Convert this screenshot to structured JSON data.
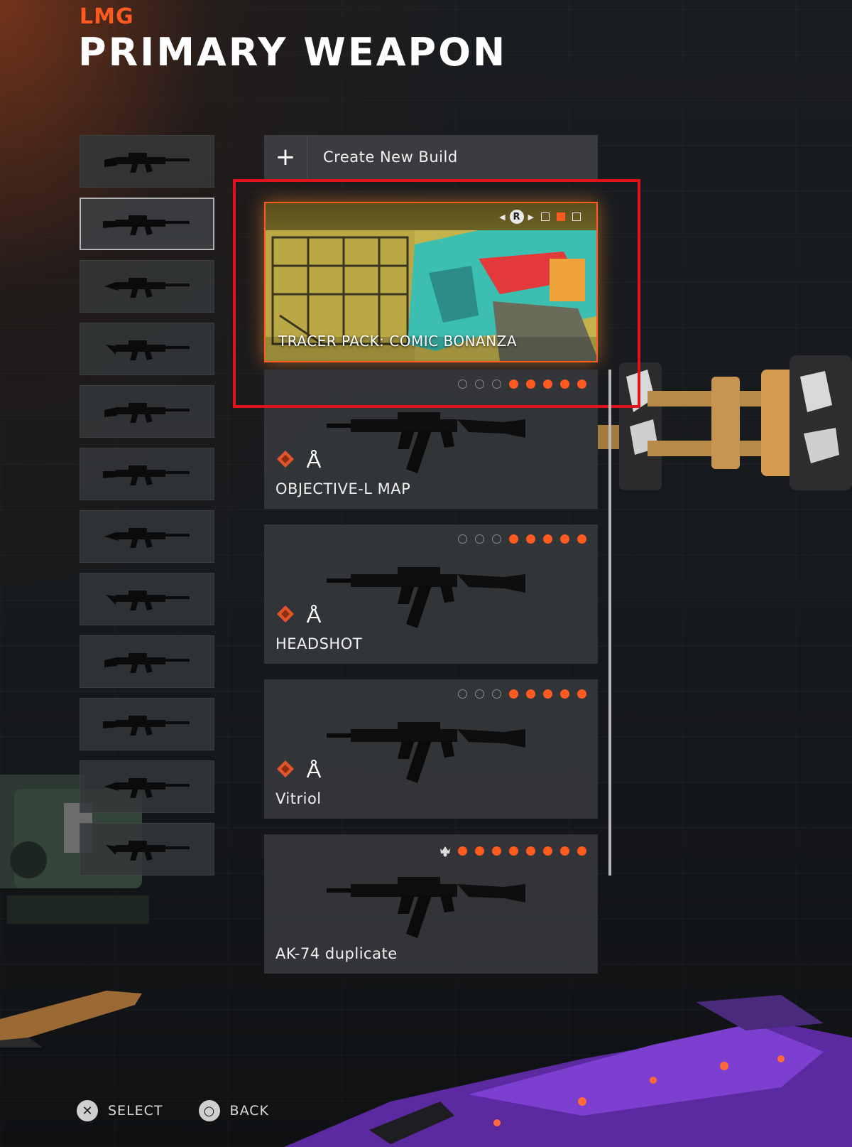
{
  "header": {
    "category": "LMG",
    "title": "PRIMARY WEAPON"
  },
  "weapon_list": {
    "count": 12,
    "selected_index": 1
  },
  "builds": {
    "create_label": "Create New Build",
    "create_icon": "plus-icon",
    "tracer_pack": {
      "title": "TRACER PACK: COMIC BONANZA",
      "nav_button": "R",
      "pages": 3,
      "active_page": 2
    },
    "cards": [
      {
        "name": "OBJECTIVE-L MAP",
        "filled_dots": 5,
        "total_dots": 8,
        "icons": [
          "diamond-rank-icon",
          "compass-blueprint-icon"
        ],
        "crown": false
      },
      {
        "name": "HEADSHOT",
        "filled_dots": 5,
        "total_dots": 8,
        "icons": [
          "diamond-rank-icon",
          "compass-blueprint-icon"
        ],
        "crown": false
      },
      {
        "name": "Vitriol",
        "filled_dots": 5,
        "total_dots": 8,
        "icons": [
          "diamond-rank-icon",
          "compass-blueprint-icon"
        ],
        "crown": false
      },
      {
        "name": "AK-74 duplicate",
        "filled_dots": 8,
        "total_dots": 8,
        "icons": [],
        "crown": true
      }
    ]
  },
  "footer": {
    "select_label": "SELECT",
    "select_button": "✕",
    "back_label": "BACK",
    "back_button": "○"
  },
  "colors": {
    "accent": "#ff5a1f",
    "highlight": "#e0121b"
  }
}
